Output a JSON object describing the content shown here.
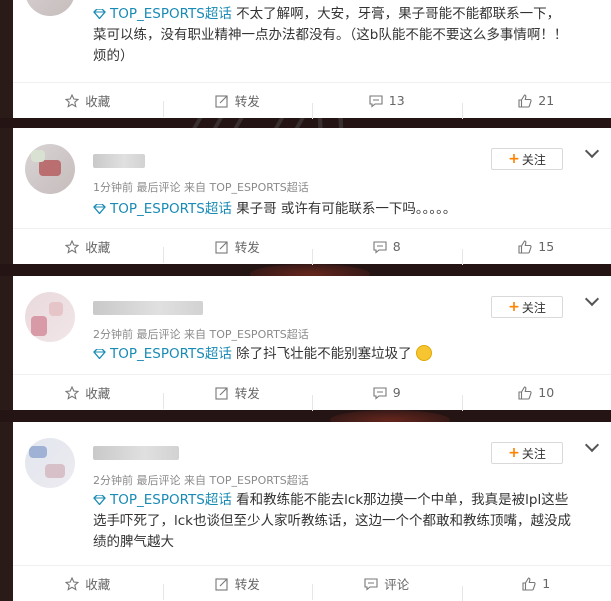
{
  "posts": [
    {
      "has_avatar": false,
      "topic": "TOP_ESPORTS超话",
      "text_lines": [
        "不太了解啊，大安，牙膏，果子哥能不能都联系一下，",
        "菜可以练，没有职业精神一点办法都没有。（这b队能不能不要这么多事情啊！！",
        "烦的）"
      ],
      "actions": {
        "favorite": "收藏",
        "repost": "转发",
        "comment": "13",
        "like": "21"
      }
    },
    {
      "has_avatar": true,
      "meta": "1分钟前 最后评论 来自 TOP_ESPORTS超话",
      "follow": "关注",
      "topic": "TOP_ESPORTS超话",
      "text_lines": [
        "果子哥 或许有可能联系一下吗。。。。。"
      ],
      "actions": {
        "favorite": "收藏",
        "repost": "转发",
        "comment": "8",
        "like": "15"
      }
    },
    {
      "has_avatar": true,
      "meta": "2分钟前 最后评论 来自 TOP_ESPORTS超话",
      "follow": "关注",
      "topic": "TOP_ESPORTS超话",
      "text_lines": [
        "除了抖飞壮能不能别塞垃圾了"
      ],
      "actions": {
        "favorite": "收藏",
        "repost": "转发",
        "comment": "9",
        "like": "10"
      }
    },
    {
      "has_avatar": true,
      "meta": "2分钟前 最后评论 来自 TOP_ESPORTS超话",
      "follow": "关注",
      "topic": "TOP_ESPORTS超话",
      "text_lines": [
        "看和教练能不能去lck那边摸一个中单，我真是被lpl这些",
        "选手吓死了，lck也谈但至少人家听教练话，这边一个个都敢和教练顶嘴，越没成",
        "绩的脾气越大"
      ],
      "actions": {
        "favorite": "收藏",
        "repost": "转发",
        "comment": "评论",
        "like": "1"
      }
    }
  ],
  "colors": {
    "topic": "#1a8bb5",
    "follow_plus": "#ff8200"
  }
}
